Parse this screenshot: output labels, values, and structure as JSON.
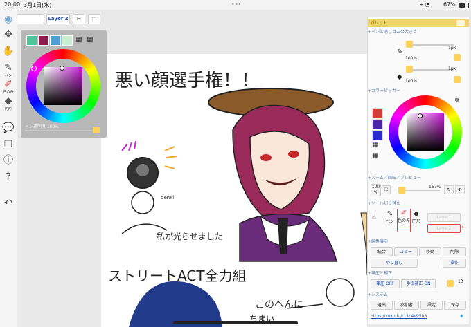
{
  "status": {
    "time": "20:00",
    "date": "3月1日(水)",
    "battery": "67%",
    "dots": "•••"
  },
  "toolbar": {
    "layer_label": "Layer 2"
  },
  "leftbar": {
    "pen_label": "ペン",
    "color_label": "色のみ",
    "round_label": "円形"
  },
  "color_popup": {
    "swatches": [
      "#4fc39a",
      "#8a1f4f",
      "#4e9fd6",
      "#c7efcf"
    ],
    "pen_opacity_label": "ペン透明度 100%"
  },
  "panel": {
    "title": "パレット",
    "pen_eraser_header": "ペンと消しゴムの大きさ",
    "pen_size": "1px",
    "pen_pct": "100%",
    "eraser_size": "1px",
    "eraser_pct": "100%",
    "color_picker_header": "カラーピッカー",
    "picker_swatches": [
      "#d43b3b",
      "#4a23a8",
      "#2b2bd0"
    ],
    "zoom_header": "ズーム／回転／プレビュー",
    "zoom_btn": "100 %",
    "zoom_value": "167%",
    "tool_switch_header": "ツール切り替え",
    "tool_pen": "ペン",
    "tool_color": "色のみ",
    "tool_round": "円形",
    "tool_layer1": "Layer1",
    "tool_layer2": "Layer2",
    "edit_header": "編集機能",
    "btn_merge": "統合",
    "btn_copy": "コピー",
    "btn_move": "移動",
    "btn_delete": "削除",
    "btn_undo": "やり直し",
    "btn_op": "操作",
    "correction_header": "筆圧と補正",
    "btn_pressure": "筆圧 OFF",
    "btn_hand": "手振補正 ON",
    "hand_value": "13",
    "system_header": "システム",
    "btn_exit": "退出",
    "btn_members": "参加者",
    "btn_settings": "設定",
    "btn_save": "保存",
    "url": "https://kuku.lu/r11c4e9588"
  },
  "canvas_text": {
    "title": "悪い顔選手権！！",
    "caption1": "私が光らせました",
    "caption2": "ストリートACT全力組",
    "caption3": "このへんに",
    "caption4": "ちまい",
    "denki": "denki"
  }
}
